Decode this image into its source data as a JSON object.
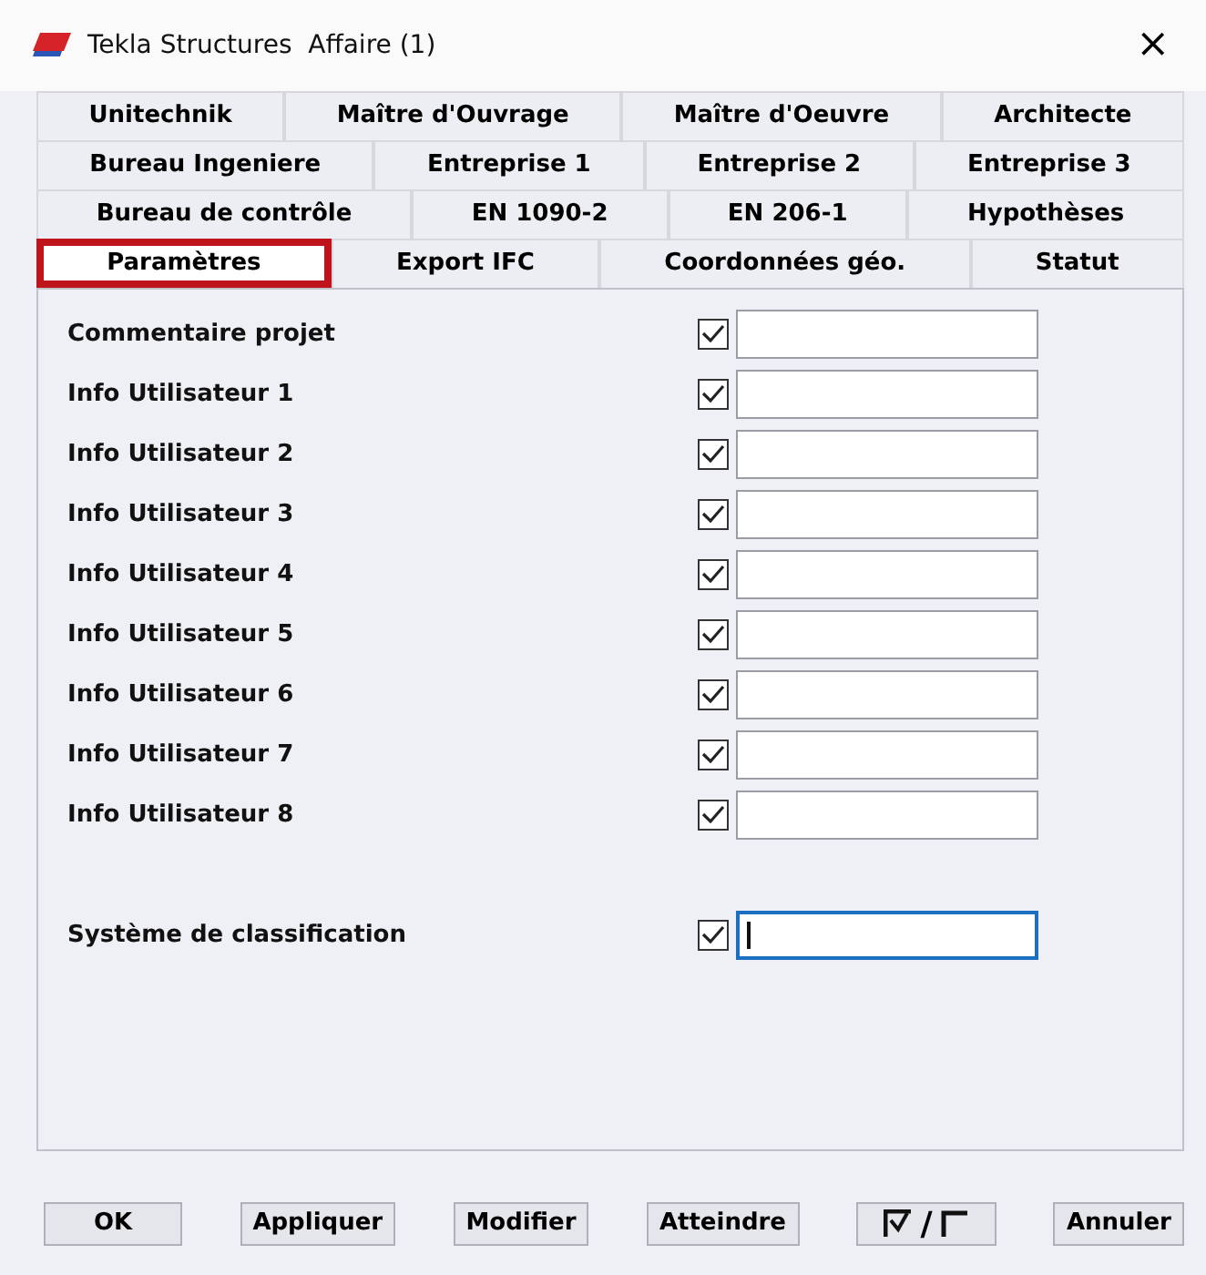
{
  "window": {
    "title": "Tekla Structures  Affaire (1)",
    "close": "×"
  },
  "tab_rows": [
    [
      {
        "label": "Unitechnik",
        "selected": false
      },
      {
        "label": "Maître d'Ouvrage",
        "selected": false
      },
      {
        "label": "Maître d'Oeuvre",
        "selected": false
      },
      {
        "label": "Architecte",
        "selected": false
      }
    ],
    [
      {
        "label": "Bureau Ingeniere",
        "selected": false
      },
      {
        "label": "Entreprise 1",
        "selected": false
      },
      {
        "label": "Entreprise 2",
        "selected": false
      },
      {
        "label": "Entreprise 3",
        "selected": false
      }
    ],
    [
      {
        "label": "Bureau de contrôle",
        "selected": false
      },
      {
        "label": "EN 1090-2",
        "selected": false
      },
      {
        "label": "EN 206-1",
        "selected": false
      },
      {
        "label": "Hypothèses",
        "selected": false
      }
    ],
    [
      {
        "label": "Paramètres",
        "selected": true
      },
      {
        "label": "Export IFC",
        "selected": false
      },
      {
        "label": "Coordonnées géo.",
        "selected": false
      },
      {
        "label": "Statut",
        "selected": false
      }
    ]
  ],
  "fields": [
    {
      "label": "Commentaire projet",
      "checked": true,
      "focused": false
    },
    {
      "label": "Info Utilisateur 1",
      "checked": true,
      "focused": false
    },
    {
      "label": "Info Utilisateur 2",
      "checked": true,
      "focused": false
    },
    {
      "label": "Info Utilisateur 3",
      "checked": true,
      "focused": false
    },
    {
      "label": "Info Utilisateur 4",
      "checked": true,
      "focused": false
    },
    {
      "label": "Info Utilisateur 5",
      "checked": true,
      "focused": false
    },
    {
      "label": "Info Utilisateur 6",
      "checked": true,
      "focused": false
    },
    {
      "label": "Info Utilisateur 7",
      "checked": true,
      "focused": false
    },
    {
      "label": "Info Utilisateur 8",
      "checked": true,
      "focused": false
    }
  ],
  "classification_fields": [
    {
      "label": "Système de classification",
      "checked": true,
      "focused": true
    }
  ],
  "buttons": [
    {
      "kind": "text",
      "label": "OK"
    },
    {
      "kind": "text",
      "label": "Appliquer"
    },
    {
      "kind": "text",
      "label": "Modifier"
    },
    {
      "kind": "text",
      "label": "Atteindre"
    },
    {
      "kind": "toggle",
      "label": "/"
    },
    {
      "kind": "text",
      "label": "Annuler"
    }
  ]
}
